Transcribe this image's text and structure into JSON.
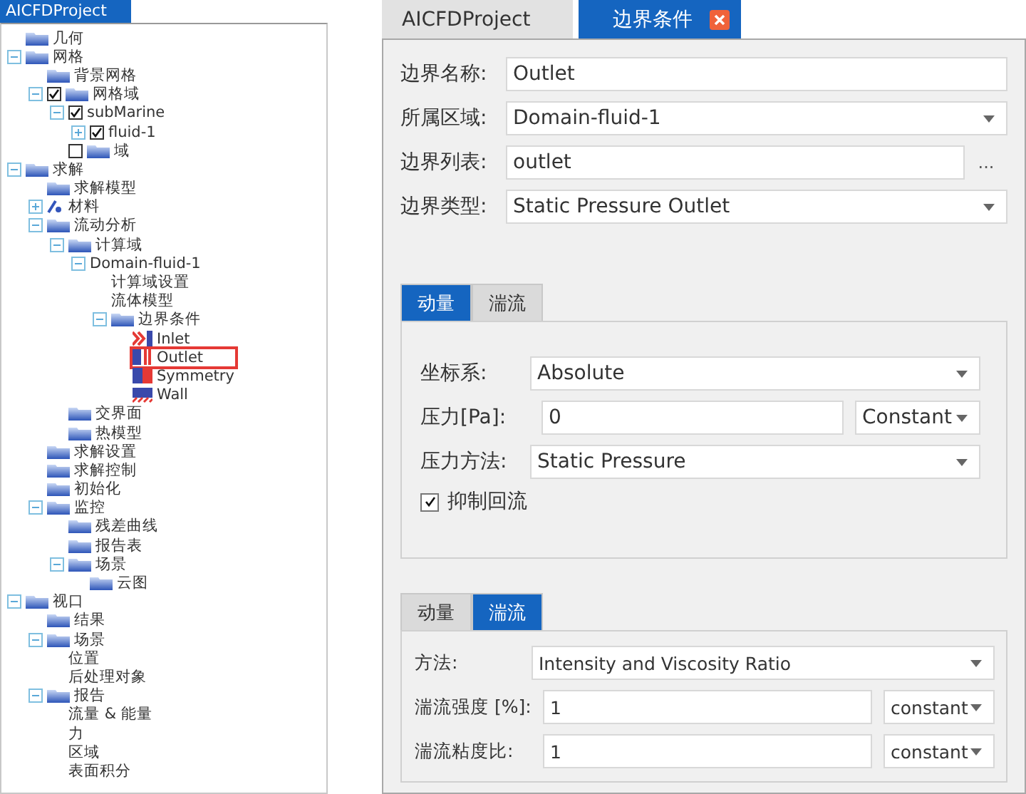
{
  "tree_panel": {
    "title": "AICFDProject",
    "items": [
      {
        "label": "几何",
        "kind": "folder"
      },
      {
        "label": "网格",
        "kind": "folder",
        "expanded": true,
        "children": [
          {
            "label": "背景网格",
            "kind": "folder"
          },
          {
            "label": "网格域",
            "kind": "folder",
            "expanded": true,
            "checked": true,
            "children": [
              {
                "label": "subMarine",
                "kind": "plain",
                "expanded": true,
                "checked": true,
                "children": [
                  {
                    "label": "fluid-1",
                    "kind": "plain",
                    "expanded": false,
                    "checked": true
                  }
                ]
              },
              {
                "label": "域",
                "kind": "folder",
                "checked": false
              }
            ]
          }
        ]
      },
      {
        "label": "求解",
        "kind": "folder",
        "expanded": true,
        "children": [
          {
            "label": "求解模型",
            "kind": "folder"
          },
          {
            "label": "材料",
            "kind": "material",
            "expanded": false
          },
          {
            "label": "流动分析",
            "kind": "folder",
            "expanded": true,
            "children": [
              {
                "label": "计算域",
                "kind": "folder",
                "expanded": true,
                "children": [
                  {
                    "label": "Domain-fluid-1",
                    "kind": "plain",
                    "expanded": true,
                    "children": [
                      {
                        "label": "计算域设置",
                        "kind": "plain"
                      },
                      {
                        "label": "流体模型",
                        "kind": "plain"
                      },
                      {
                        "label": "边界条件",
                        "kind": "folder",
                        "expanded": true,
                        "children": [
                          {
                            "label": "Inlet",
                            "kind": "inlet",
                            "highlighted": false
                          },
                          {
                            "label": "Outlet",
                            "kind": "outlet",
                            "highlighted": true
                          },
                          {
                            "label": "Symmetry",
                            "kind": "symmetry",
                            "highlighted": false
                          },
                          {
                            "label": "Wall",
                            "kind": "wall",
                            "highlighted": false
                          }
                        ]
                      }
                    ]
                  }
                ]
              },
              {
                "label": "交界面",
                "kind": "folder"
              },
              {
                "label": "热模型",
                "kind": "folder"
              }
            ]
          },
          {
            "label": "求解设置",
            "kind": "folder"
          },
          {
            "label": "求解控制",
            "kind": "folder"
          },
          {
            "label": "初始化",
            "kind": "folder"
          },
          {
            "label": "监控",
            "kind": "folder",
            "expanded": true,
            "children": [
              {
                "label": "残差曲线",
                "kind": "folder"
              },
              {
                "label": "报告表",
                "kind": "folder"
              },
              {
                "label": "场景",
                "kind": "folder",
                "expanded": true,
                "children": [
                  {
                    "label": "云图",
                    "kind": "folder"
                  }
                ]
              }
            ]
          }
        ]
      },
      {
        "label": "视口",
        "kind": "folder",
        "expanded": true,
        "children": [
          {
            "label": "结果",
            "kind": "folder"
          },
          {
            "label": "场景",
            "kind": "folder",
            "expanded": true,
            "children": [
              {
                "label": "位置",
                "kind": "plain"
              },
              {
                "label": "后处理对象",
                "kind": "plain"
              }
            ]
          },
          {
            "label": "报告",
            "kind": "folder",
            "expanded": true,
            "children": [
              {
                "label": "流量 & 能量",
                "kind": "plain"
              },
              {
                "label": "力",
                "kind": "plain"
              },
              {
                "label": "区域",
                "kind": "plain"
              },
              {
                "label": "表面积分",
                "kind": "plain"
              }
            ]
          }
        ]
      }
    ]
  },
  "editor": {
    "tabs": [
      {
        "label": "AICFDProject",
        "selected": false,
        "closable": false
      },
      {
        "label": "边界条件",
        "selected": true,
        "closable": true
      }
    ],
    "fields": [
      {
        "label": "边界名称:",
        "kind": "text",
        "value": "Outlet"
      },
      {
        "label": "所属区域:",
        "kind": "select",
        "value": "Domain-fluid-1"
      },
      {
        "label": "边界列表:",
        "kind": "browse",
        "value": "outlet",
        "button": "..."
      },
      {
        "label": "边界类型:",
        "kind": "select",
        "value": "Static Pressure Outlet"
      }
    ],
    "momentum_panel": {
      "tabs": [
        {
          "label": "动量",
          "selected": true
        },
        {
          "label": "湍流",
          "selected": false
        }
      ],
      "fields": [
        {
          "label": "坐标系:",
          "kind": "select",
          "value": "Absolute"
        },
        {
          "label": "压力[Pa]:",
          "kind": "text_unit",
          "value": "0",
          "unit": "Constant"
        },
        {
          "label": "压力方法:",
          "kind": "select",
          "value": "Static Pressure"
        }
      ],
      "checkbox": {
        "label": "抑制回流",
        "checked": true
      }
    },
    "turbulence_panel": {
      "tabs": [
        {
          "label": "动量",
          "selected": false
        },
        {
          "label": "湍流",
          "selected": true
        }
      ],
      "fields": [
        {
          "label": "方法:",
          "kind": "select",
          "value": "Intensity and Viscosity Ratio"
        },
        {
          "label": "湍流强度 [%]:",
          "kind": "text_unit",
          "value": "1",
          "unit": "constant"
        },
        {
          "label": "湍流粘度比:",
          "kind": "text_unit",
          "value": "1",
          "unit": "constant"
        }
      ]
    }
  }
}
